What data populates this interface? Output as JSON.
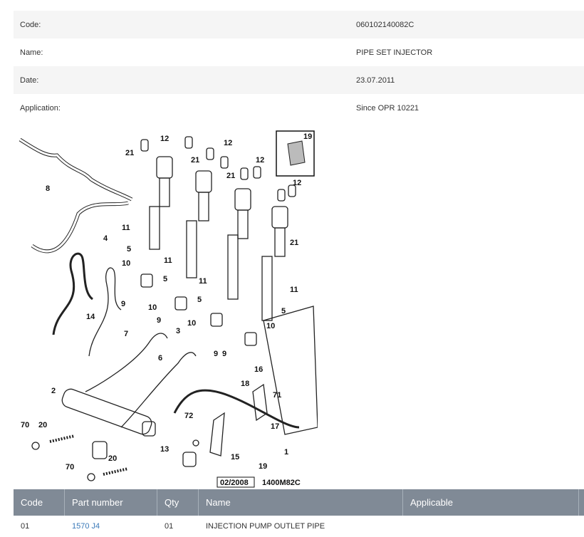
{
  "info": [
    {
      "label": "Code:",
      "value": "060102140082C"
    },
    {
      "label": "Name:",
      "value": "PIPE SET INJECTOR"
    },
    {
      "label": "Date:",
      "value": "23.07.2011"
    },
    {
      "label": "Application:",
      "value": "Since OPR 10221"
    }
  ],
  "diagram": {
    "ref_date": "02/2008",
    "ref_code": "1400M82C",
    "inset_callout": "19",
    "callouts": [
      "12",
      "12",
      "12",
      "12",
      "21",
      "21",
      "21",
      "21",
      "8",
      "4",
      "11",
      "11",
      "11",
      "11",
      "5",
      "5",
      "5",
      "5",
      "10",
      "10",
      "10",
      "10",
      "9",
      "9",
      "9",
      "9",
      "14",
      "7",
      "3",
      "6",
      "16",
      "18",
      "71",
      "17",
      "2",
      "70",
      "20",
      "70",
      "20",
      "13",
      "72",
      "15",
      "19",
      "1"
    ]
  },
  "parts_table": {
    "headers": [
      "Code",
      "Part number",
      "Qty",
      "Name",
      "Applicable"
    ],
    "rows": [
      {
        "code": "01",
        "part_number": "1570 J4",
        "qty": "01",
        "name": "INJECTION PUMP OUTLET PIPE",
        "applicable": ""
      }
    ]
  }
}
